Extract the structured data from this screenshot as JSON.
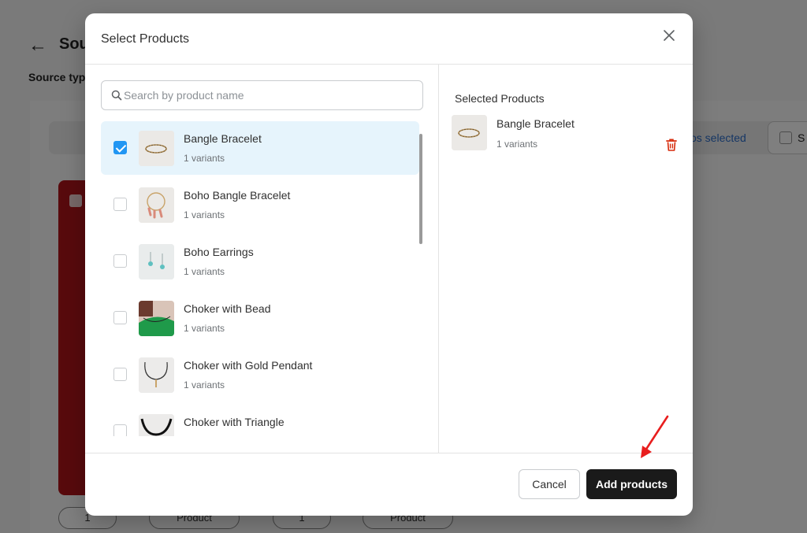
{
  "background": {
    "title_partial": "Sou",
    "source_label_partial": "Source typ",
    "selected_text_partial": "os selected",
    "checkbox_label_partial": "S",
    "pill_labels": [
      "1",
      "Product",
      "1",
      "Product"
    ]
  },
  "modal": {
    "title": "Select Products",
    "search": {
      "placeholder": "Search by product name",
      "value": ""
    },
    "products": [
      {
        "name": "Bangle Bracelet",
        "variants": "1 variants",
        "checked": true
      },
      {
        "name": "Boho Bangle Bracelet",
        "variants": "1 variants",
        "checked": false
      },
      {
        "name": "Boho Earrings",
        "variants": "1 variants",
        "checked": false
      },
      {
        "name": "Choker with Bead",
        "variants": "1 variants",
        "checked": false
      },
      {
        "name": "Choker with Gold Pendant",
        "variants": "1 variants",
        "checked": false
      },
      {
        "name": "Choker with Triangle",
        "variants": "",
        "checked": false
      }
    ],
    "selected_section": {
      "title": "Selected Products",
      "items": [
        {
          "name": "Bangle Bracelet",
          "variants": "1 variants"
        }
      ]
    },
    "footer": {
      "cancel_label": "Cancel",
      "add_label": "Add products"
    }
  },
  "colors": {
    "accent_check": "#2196f3",
    "selected_row_bg": "#e6f4fc",
    "primary_button": "#1a1a1a",
    "trash": "#d72c0d",
    "annotation_arrow": "#e81e1e"
  },
  "icons": {
    "close": "close-icon",
    "search": "search-icon",
    "trash": "trash-icon",
    "back": "arrow-left-icon"
  }
}
